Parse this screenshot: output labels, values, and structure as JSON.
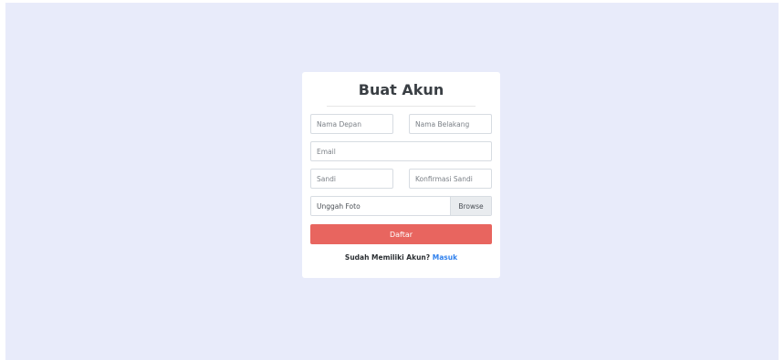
{
  "form": {
    "title": "Buat Akun",
    "first_name_placeholder": "Nama Depan",
    "last_name_placeholder": "Nama Belakang",
    "email_placeholder": "Email",
    "password_placeholder": "Sandi",
    "confirm_password_placeholder": "Konfirmasi Sandi",
    "photo_label": "Unggah Foto",
    "browse_label": "Browse",
    "submit_label": "Daftar",
    "login_prompt": "Sudah Memiliki Akun?",
    "login_link": "Masuk"
  },
  "colors": {
    "background": "#e8ebfa",
    "submit": "#e8655f",
    "link": "#2f80ed"
  }
}
